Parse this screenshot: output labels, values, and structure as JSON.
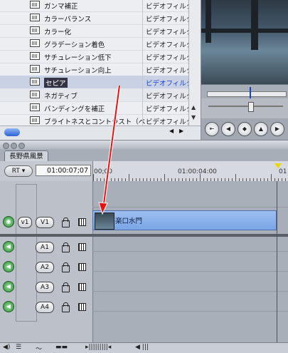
{
  "browser": {
    "rows": [
      {
        "name": "ガンマ補正",
        "type": "ビデオフィルタ"
      },
      {
        "name": "カラーバランス",
        "type": "ビデオフィルタ"
      },
      {
        "name": "カラー化",
        "type": "ビデオフィルタ"
      },
      {
        "name": "グラデーション着色",
        "type": "ビデオフィルタ"
      },
      {
        "name": "サチュレーション低下",
        "type": "ビデオフィルタ"
      },
      {
        "name": "サチュレーション向上",
        "type": "ビデオフィルタ"
      },
      {
        "name": "セピア",
        "type": "ビデオフィルタ"
      },
      {
        "name": "ネガティブ",
        "type": "ビデオフィルタ"
      },
      {
        "name": "バンディングを補正",
        "type": "ビデオフィルタ"
      },
      {
        "name": "ブライトネスとコントラスト（ベ",
        "type": "ビデオフィルタ"
      }
    ]
  },
  "timeline": {
    "tab_label": "長野県風景",
    "rt_label": "RT ▾",
    "timecode": "01:00:07;07",
    "ruler_labels": [
      "00;00",
      "01:00:04:00",
      "01"
    ],
    "video_tracks": [
      {
        "source": "v1",
        "dest": "V1"
      }
    ],
    "audio_tracks": [
      {
        "dest": "A1"
      },
      {
        "dest": "A2"
      },
      {
        "dest": "A3"
      },
      {
        "dest": "A4"
      }
    ],
    "clip_name": "楽口水門"
  },
  "colors": {
    "selection_type": "#1a3fd8",
    "clip": "#8fb4ec",
    "arrow": "#e81010"
  }
}
